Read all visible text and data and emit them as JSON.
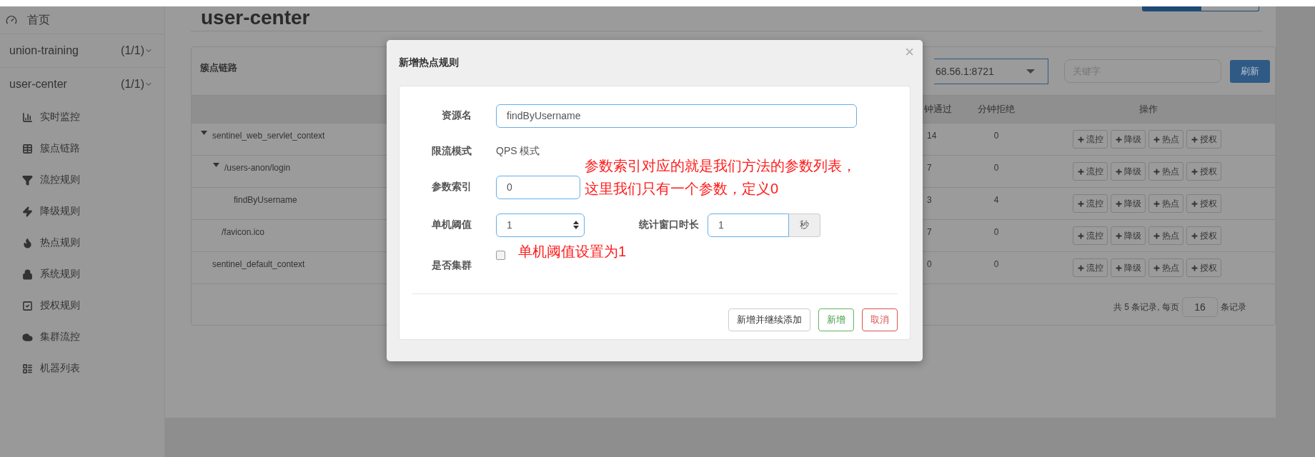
{
  "page": {
    "title": "user-center"
  },
  "sidebar": {
    "home": "首页",
    "apps": [
      {
        "name": "union-training",
        "count": "(1/1)"
      },
      {
        "name": "user-center",
        "count": "(1/1)",
        "items": [
          "实时监控",
          "簇点链路",
          "流控规则",
          "降级规则",
          "热点规则",
          "系统规则",
          "授权规则",
          "集群流控",
          "机器列表"
        ]
      }
    ]
  },
  "panel": {
    "title": "簇点链路",
    "machine": "68.56.1:8721",
    "search": {
      "placeholder": "关键字"
    },
    "refresh": "刷新",
    "columns": [
      "钟通过",
      "分钟拒绝",
      "操作"
    ],
    "rows": [
      {
        "resource": "sentinel_web_servlet_context",
        "pass": "14",
        "block": "0",
        "actions": [
          "流控",
          "降级",
          "热点",
          "授权"
        ],
        "expanded": true,
        "children": [
          {
            "resource": "/users-anon/login",
            "pass": "7",
            "block": "0",
            "actions": [
              "流控",
              "降级",
              "热点",
              "授权"
            ],
            "expanded": true,
            "children": [
              {
                "resource": "findByUsername",
                "pass": "3",
                "block": "4",
                "actions": [
                  "流控",
                  "降级",
                  "热点",
                  "授权"
                ]
              }
            ]
          },
          {
            "resource": "/favicon.ico",
            "pass": "7",
            "block": "0",
            "actions": [
              "流控",
              "降级",
              "热点",
              "授权"
            ]
          }
        ]
      },
      {
        "resource": "sentinel_default_context",
        "pass": "0",
        "block": "0",
        "actions": [
          "流控",
          "降级",
          "热点",
          "授权"
        ]
      }
    ],
    "pagination": {
      "summary": "共 5 条记录, 每页",
      "page_size": "16",
      "suffix": "条记录"
    }
  },
  "dialog": {
    "title": "新增热点规则",
    "close": "×",
    "fields": [
      {
        "kind": "text",
        "label": "资源名",
        "value": "findByUsername"
      },
      {
        "kind": "static",
        "label": "限流模式",
        "value": "QPS 模式"
      },
      {
        "kind": "text",
        "label": "参数索引",
        "value": "0"
      },
      {
        "kind": "pair",
        "label": "单机阈值",
        "value": "1",
        "label2": "统计窗口时长",
        "value2": "1",
        "unit": "秒"
      },
      {
        "kind": "checkbox",
        "label": "是否集群",
        "checked": false
      }
    ],
    "buttons": [
      {
        "label": "新增并继续添加",
        "kind": "default"
      },
      {
        "label": "新增",
        "kind": "success"
      },
      {
        "label": "取消",
        "kind": "danger"
      }
    ]
  },
  "annotations": [
    {
      "lines": [
        "参数索引对应的就是我们方法的参数列表，",
        "这里我们只有一个参数，定义0"
      ]
    },
    {
      "lines": [
        "单机阈值设置为1"
      ]
    }
  ]
}
